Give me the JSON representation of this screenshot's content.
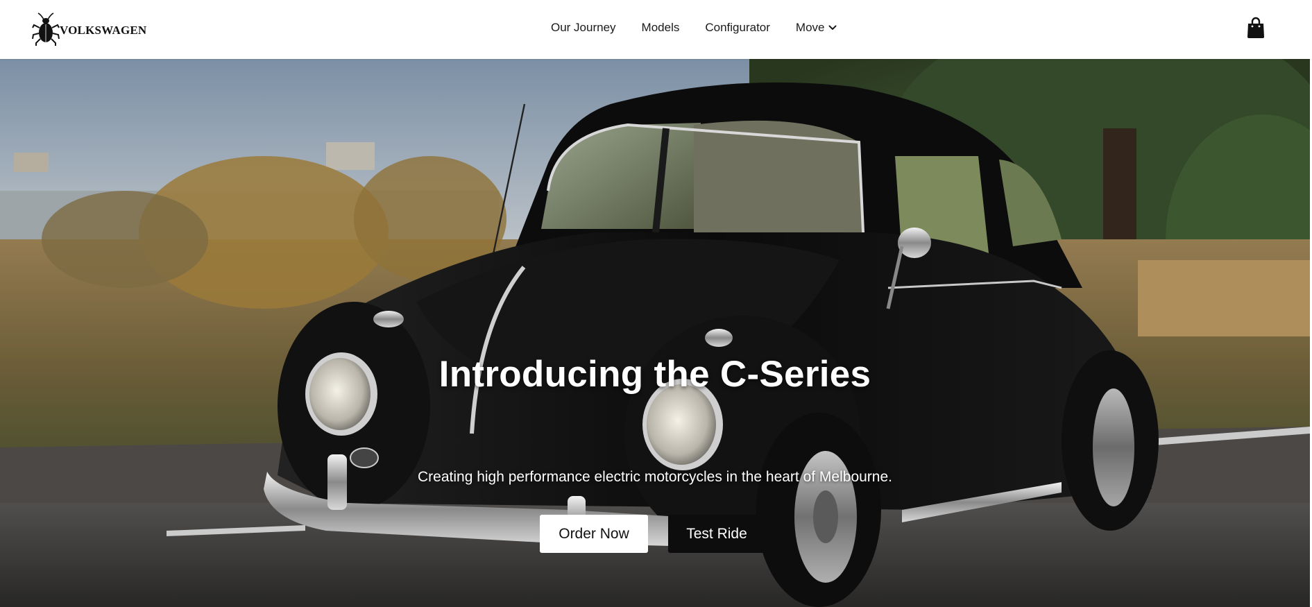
{
  "brand": {
    "name": "VOLKSWAGEN",
    "logo_icon": "beetle-icon"
  },
  "nav": {
    "items": [
      {
        "label": "Our Journey"
      },
      {
        "label": "Models"
      },
      {
        "label": "Configurator"
      },
      {
        "label": "Move",
        "icon": "chevron-down-icon"
      }
    ],
    "cart_icon": "shopping-bag-icon"
  },
  "hero": {
    "title": "Introducing the C-Series",
    "subtitle": "Creating high performance electric motorcycles in the heart of Melbourne.",
    "primary_button": "Order Now",
    "secondary_button": "Test Ride"
  },
  "colors": {
    "nav_background": "#ffffff",
    "text_dark": "#1a1a1a",
    "primary_button_bg": "#ffffff",
    "secondary_button_bg": "#0d0d0d"
  }
}
